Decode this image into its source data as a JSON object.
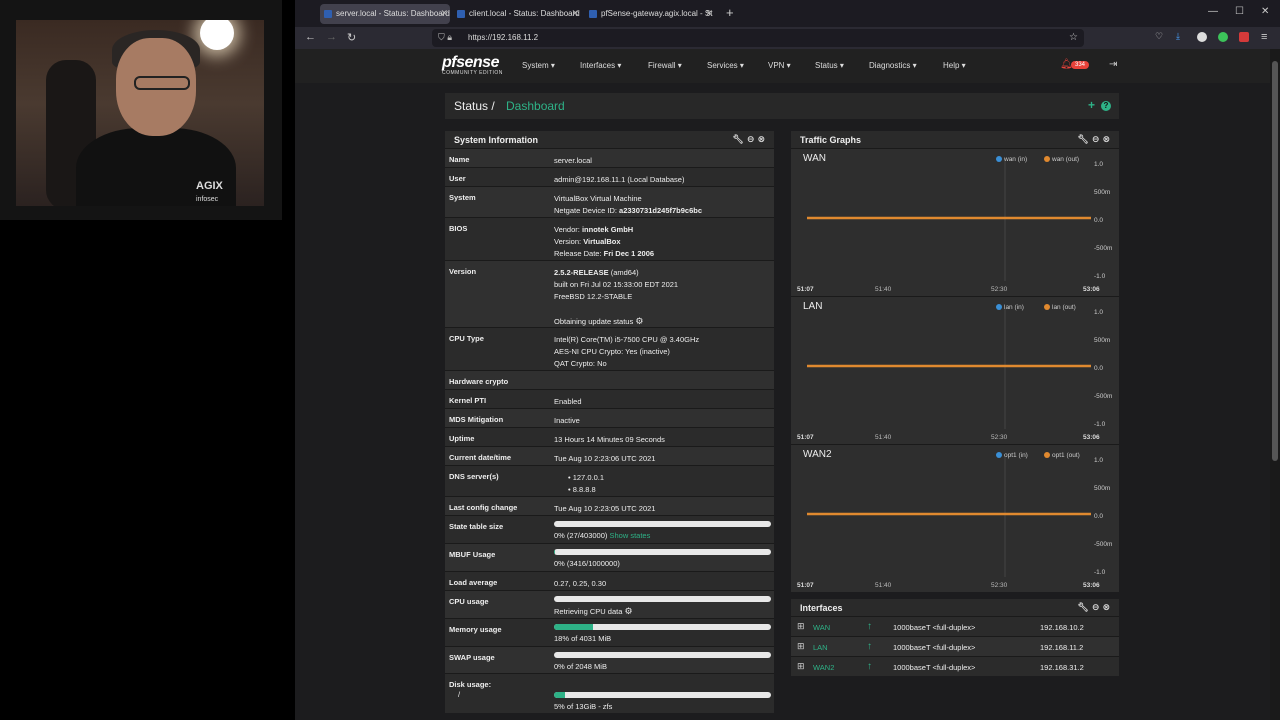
{
  "webcam": {
    "shirt_text": "AGIX",
    "shirt_sub": "infosec"
  },
  "browser": {
    "tabs": [
      {
        "title": "server.local - Status: Dashboard",
        "active": true
      },
      {
        "title": "client.local - Status: Dashboard",
        "active": false
      },
      {
        "title": "pfSense-gateway.agix.local - St",
        "active": false
      }
    ],
    "url": "https://192.168.11.2"
  },
  "pfsense": {
    "logo": "pfsense",
    "logo_sub": "COMMUNITY EDITION",
    "menu": [
      "System ▾",
      "Interfaces ▾",
      "Firewall ▾",
      "Services ▾",
      "VPN ▾",
      "Status ▾",
      "Diagnostics ▾",
      "Help ▾"
    ],
    "notifications": "334"
  },
  "breadcrumb": {
    "section": "Status /",
    "page": "Dashboard"
  },
  "system_information": {
    "title": "System Information",
    "rows": {
      "name": {
        "label": "Name",
        "value": "server.local"
      },
      "user": {
        "label": "User",
        "value": "admin@192.168.11.1 (Local Database)"
      },
      "system": {
        "label": "System",
        "line1": "VirtualBox Virtual Machine",
        "line2_prefix": "Netgate Device ID: ",
        "line2_value": "a2330731d245f7b9c6bc"
      },
      "bios": {
        "label": "BIOS",
        "vendor_prefix": "Vendor: ",
        "vendor": "innotek GmbH",
        "version_prefix": "Version: ",
        "version": "VirtualBox",
        "date_prefix": "Release Date: ",
        "date": "Fri Dec 1 2006"
      },
      "version": {
        "label": "Version",
        "release": "2.5.2-RELEASE",
        "arch": " (amd64)",
        "built": "built on Fri Jul 02 15:33:00 EDT 2021",
        "os": "FreeBSD 12.2-STABLE",
        "update": "Obtaining update status"
      },
      "cpu_type": {
        "label": "CPU Type",
        "line1": "Intel(R) Core(TM) i5-7500 CPU @ 3.40GHz",
        "line2": "AES-NI CPU Crypto: Yes (inactive)",
        "line3": "QAT Crypto: No"
      },
      "hardware_crypto": {
        "label": "Hardware crypto",
        "value": ""
      },
      "kernel_pti": {
        "label": "Kernel PTI",
        "value": "Enabled"
      },
      "mds": {
        "label": "MDS Mitigation",
        "value": "Inactive"
      },
      "uptime": {
        "label": "Uptime",
        "value": "13 Hours 14 Minutes 09 Seconds"
      },
      "datetime": {
        "label": "Current date/time",
        "value": "Tue Aug 10 2:23:06 UTC 2021"
      },
      "dns": {
        "label": "DNS server(s)",
        "servers": [
          "127.0.0.1",
          "8.8.8.8"
        ]
      },
      "last_config": {
        "label": "Last config change",
        "value": "Tue Aug 10 2:23:05 UTC 2021"
      },
      "state_table": {
        "label": "State table size",
        "value": "0% (27/403000)",
        "link": "Show states",
        "fraction": 0.0001
      },
      "mbuf": {
        "label": "MBUF Usage",
        "value": "0% (3416/1000000)",
        "fraction": 0.003
      },
      "load": {
        "label": "Load average",
        "value": "0.27, 0.25, 0.30"
      },
      "cpu": {
        "label": "CPU usage",
        "value": "Retrieving CPU data",
        "fraction": 0
      },
      "memory": {
        "label": "Memory usage",
        "value": "18% of 4031 MiB",
        "fraction": 0.18
      },
      "swap": {
        "label": "SWAP usage",
        "value": "0% of 2048 MiB",
        "fraction": 0
      },
      "disk": {
        "label": "Disk usage:",
        "mount": "/",
        "value": "5% of 13GiB - zfs",
        "fraction": 0.05
      }
    }
  },
  "traffic_graphs": {
    "title": "Traffic Graphs",
    "graphs": [
      {
        "name": "WAN",
        "in": "wan (in)",
        "out": "wan (out)"
      },
      {
        "name": "LAN",
        "in": "lan (in)",
        "out": "lan (out)"
      },
      {
        "name": "WAN2",
        "in": "opt1 (in)",
        "out": "opt1 (out)"
      }
    ],
    "yticks": [
      "1.0",
      "500m",
      "0.0",
      "-500m",
      "-1.0"
    ],
    "xticks": [
      "51:07",
      "51:40",
      "52:30",
      "53:06"
    ]
  },
  "interfaces": {
    "title": "Interfaces",
    "rows": [
      {
        "name": "WAN",
        "media": "1000baseT <full-duplex>",
        "ip": "192.168.10.2"
      },
      {
        "name": "LAN",
        "media": "1000baseT <full-duplex>",
        "ip": "192.168.11.2"
      },
      {
        "name": "WAN2",
        "media": "1000baseT <full-duplex>",
        "ip": "192.168.31.2"
      }
    ]
  },
  "colors": {
    "accent": "#2eb287",
    "series_in": "#3a8fd6",
    "series_out": "#e0892f",
    "alert": "#e8423a"
  }
}
